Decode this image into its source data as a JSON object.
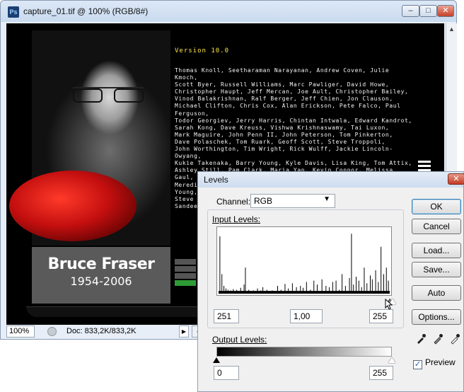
{
  "document": {
    "title": "capture_01.tif @ 100% (RGB/8#)",
    "app_icon": "Ps",
    "minimize_glyph": "–",
    "maximize_glyph": "□",
    "close_glyph": "✕",
    "zoom": "100%",
    "doc_size": "Doc: 833,2K/833,2K"
  },
  "splash": {
    "version": "Version 10.0",
    "credits": "Thomas Knoll, Seetharaman Narayanan, Andrew Coven, Julie Kmoch,\nScott Byer, Russell Williams, Marc Pawliger, David Howe,\nChristopher Haupt, Jeff Mercan, Joe Ault, Christopher Bailey,\nVinod Balakrishnan, Ralf Berger, Jeff Chien, Jon Clauson,\nMichael Clifton, Chris Cox, Alan Erickson, Pete Falco, Paul Ferguson,\nTodor Georgiev, Jerry Harris, Chintan Intwala, Edward Kandrot,\nSarah Kong, Dave Kreuss, Vishwa Krishnaswamy, Tai Luxon,\nMark Maguire, John Penn II, John Peterson, Tom Pinkerton,\nDave Polaschek, Tom Ruark, Geoff Scott, Steve Troppoli,\nJohn Worthington, Tim Wright, Rick Wulff, Jackie Lincoln-Owyang,\nKukie Takenaka, Barry Young, Kyle Davis, Lisa King, Tom Attix,\nAshley Still, Pam Clark, Maria Yap, Kevin Connor, Melissa Gaul,\nMeredith Payne-Stotzner, Daniel Wu, Teruko Kobayashi, Barry Young,\nSteve Guilhamet, David Howe, Zorana Gee, Barbara Rice,\nSandeep Singh"
  },
  "memorial": {
    "name": "Bruce Fraser",
    "years": "1954-2006"
  },
  "levels": {
    "title": "Levels",
    "close_glyph": "✕",
    "channel_label": "Channel:",
    "channel_value": "RGB",
    "input_levels_label": "Input Levels:",
    "input_black": "251",
    "input_gamma": "1,00",
    "input_white": "255",
    "output_levels_label": "Output Levels:",
    "output_black": "0",
    "output_white": "255",
    "buttons": {
      "ok": "OK",
      "cancel": "Cancel",
      "load": "Load...",
      "save": "Save...",
      "auto": "Auto",
      "options": "Options..."
    },
    "preview_label": "Preview",
    "preview_checked": true
  },
  "chart_data": {
    "type": "bar",
    "title": "",
    "xlabel": "",
    "ylabel": "",
    "xlim": [
      0,
      255
    ],
    "ylim": [
      0,
      100
    ],
    "x": [
      2,
      5,
      8,
      11,
      14,
      18,
      22,
      27,
      33,
      38,
      40,
      45,
      52,
      58,
      63,
      66,
      72,
      80,
      88,
      93,
      99,
      104,
      110,
      116,
      122,
      126,
      131,
      137,
      142,
      147,
      154,
      160,
      165,
      170,
      175,
      180,
      184,
      189,
      195,
      198,
      201,
      205,
      209,
      213,
      217,
      221,
      226,
      229,
      234,
      238,
      242,
      246,
      250,
      253
    ],
    "values": [
      88,
      30,
      12,
      8,
      6,
      5,
      7,
      6,
      9,
      14,
      40,
      6,
      5,
      8,
      5,
      10,
      6,
      5,
      12,
      6,
      15,
      8,
      16,
      10,
      12,
      9,
      18,
      6,
      20,
      14,
      22,
      12,
      10,
      18,
      20,
      6,
      30,
      12,
      24,
      92,
      14,
      26,
      20,
      10,
      40,
      16,
      28,
      22,
      36,
      18,
      72,
      30,
      40,
      20
    ]
  }
}
